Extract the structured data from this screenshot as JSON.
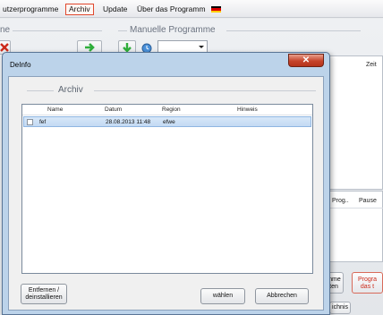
{
  "menubar": {
    "items": [
      "utzerprogramme",
      "Archiv",
      "Update",
      "Über das Programm"
    ],
    "active_index": 1,
    "flag_colors": [
      "#000000",
      "#dd0000",
      "#ffce00"
    ]
  },
  "background": {
    "left_group_title": "ne",
    "manual_group_title": "Manuelle Programme",
    "right_column_header": "Zeit",
    "right_table_headers": [
      "Prog..",
      "Pause"
    ],
    "side_buttons": [
      "mme\nten",
      "Progra\ndas t"
    ],
    "bottom_button": "ichnis",
    "accent_red": "#cc2a1a",
    "accent_green": "#2fae3a"
  },
  "dialog": {
    "title": "DeInfo",
    "close_symbol": "✕",
    "archive_group_title": "Archiv",
    "columns": [
      "Name",
      "Datum",
      "Region",
      "Hinweis"
    ],
    "rows": [
      {
        "name": "fef",
        "date": "28.08.2013 11:48",
        "region": "efwe",
        "note": ""
      }
    ],
    "buttons": {
      "remove": "Entfernen / deinstallieren",
      "choose": "wählen",
      "cancel": "Abbrechen"
    },
    "selection_color": "#c9def4"
  }
}
